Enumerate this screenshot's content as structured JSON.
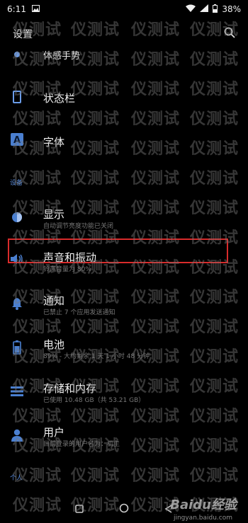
{
  "status_bar": {
    "time": "6:11",
    "battery": "38%"
  },
  "app_bar": {
    "title": "设置"
  },
  "rows": [
    {
      "label": "体感手势",
      "sub": "",
      "icon": "gesture-icon"
    },
    {
      "label": "状态栏",
      "sub": "",
      "icon": "status-bar-icon"
    },
    {
      "label": "字体",
      "sub": "",
      "icon": "font-icon"
    },
    {
      "label": "显示",
      "sub": "自动调节亮度功能已关闭",
      "icon": "display-icon"
    },
    {
      "label": "声音和振动",
      "sub": "铃声音量为 80%",
      "icon": "sound-icon"
    },
    {
      "label": "通知",
      "sub": "已禁止 7 个应用发送通知",
      "icon": "notification-icon"
    },
    {
      "label": "电池",
      "sub": "89% - 大约剩余 1 天 1 小时 48 分钟",
      "icon": "battery-icon"
    },
    {
      "label": "存储和内存",
      "sub": "已使用 10.48 GB（共 53.21 GB）",
      "icon": "storage-icon"
    },
    {
      "label": "用户",
      "sub": "目前登录的用户名为：机主",
      "icon": "user-icon"
    }
  ],
  "sections": {
    "device": "设备",
    "personal": "个人"
  },
  "watermark": {
    "text": "仪测试"
  },
  "credit": {
    "brand": "Baidu经验",
    "url": "jingyan.baidu.com"
  },
  "colors": {
    "accent": "#5a8ad8",
    "highlight": "#d92b2b",
    "background": "#000000"
  }
}
